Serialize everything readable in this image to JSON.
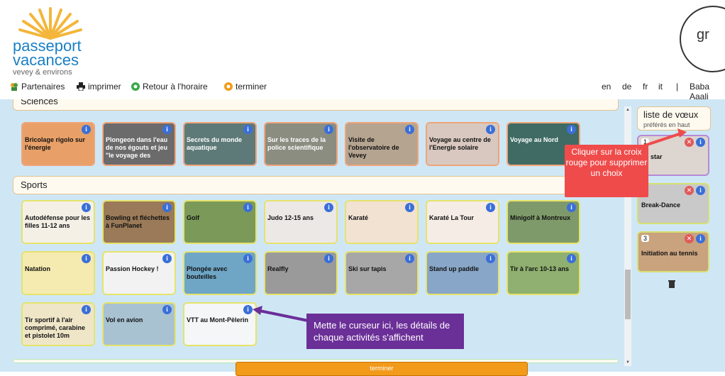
{
  "header": {
    "logo_line1": "passeport",
    "logo_line2": "vacances",
    "logo_line3": "vevey & environs",
    "right_logo_text": "gr",
    "nav": {
      "partners": "Partenaires",
      "print": "imprimer",
      "back": "Retour à l'horaire",
      "finish": "terminer"
    },
    "languages": [
      "en",
      "de",
      "fr",
      "it"
    ],
    "separator": "|",
    "user": "Baba Aaali"
  },
  "sections": {
    "sciences": "Sciences",
    "sports": "Sports"
  },
  "sciences_cards": [
    {
      "label": "Bricolage rigolo sur l'énergie",
      "color": "#e8a068"
    },
    {
      "label": "Plongeon dans l'eau de nos égouts et jeu \"le voyage des",
      "color": "#6b6b6b"
    },
    {
      "label": "Secrets du monde aquatique",
      "color": "#5e7a78"
    },
    {
      "label": "Sur les traces de la police scientifique",
      "color": "#8a8d80"
    },
    {
      "label": "Visite de l'observatoire de Vevey",
      "color": "#b5a490"
    },
    {
      "label": "Voyage au centre de l'Energie solaire",
      "color": "#d9c8c0"
    },
    {
      "label": "Voyage au Nord",
      "color": "#3f6b64"
    }
  ],
  "sports_cards": [
    {
      "label": "Autodéfense pour les filles 11-12 ans",
      "color": "#f4f0e6"
    },
    {
      "label": "Bowling et fléchettes à FunPlanet",
      "color": "#9a7a58"
    },
    {
      "label": "Golf",
      "color": "#7b9a5a"
    },
    {
      "label": "Judo 12-15 ans",
      "color": "#ece8e6"
    },
    {
      "label": "Karaté",
      "color": "#f2e2d2"
    },
    {
      "label": "Karaté La Tour",
      "color": "#f5ece6"
    },
    {
      "label": "Minigolf à Montreux",
      "color": "#7f9a6a"
    },
    {
      "label": "Natation",
      "color": "#f5ebb0"
    },
    {
      "label": "Passion Hockey !",
      "color": "#f2f2f2"
    },
    {
      "label": "Plongée avec bouteilles",
      "color": "#6fa6c6"
    },
    {
      "label": "Realfly",
      "color": "#9a9a9a"
    },
    {
      "label": "Ski sur tapis",
      "color": "#a7a7a7"
    },
    {
      "label": "Stand up paddle",
      "color": "#88a6c8"
    },
    {
      "label": "Tir à l'arc 10-13 ans",
      "color": "#8fb070"
    },
    {
      "label": "Tir sportif à l'air comprimé, carabine et pistolet 10m",
      "color": "#efe6c8"
    },
    {
      "label": "Vol en avion",
      "color": "#a8c2d2"
    },
    {
      "label": "VTT au Mont-Pèlerin",
      "color": "#f4f6f8"
    }
  ],
  "info_glyph": "i",
  "wishlist": {
    "title": "liste de vœux",
    "subtitle": "préférés en haut",
    "remove_glyph": "✕",
    "items": [
      {
        "rank": "1",
        "label": "de star",
        "color": "#ddd5cf",
        "border": "#b58ad8"
      },
      {
        "rank": "",
        "label": "Break-Dance",
        "color": "#c9c9c9",
        "border": "#d7e070"
      },
      {
        "rank": "3",
        "label": "Initiation au tennis",
        "color": "#c9a27e",
        "border": "#d7e070"
      }
    ]
  },
  "callouts": {
    "red": "Cliquer sur la croix rouge pour supprimer un choix",
    "purple": "Mette le curseur ici, les détails de chaque activités s'affichent"
  },
  "bottom_button": "terminer"
}
